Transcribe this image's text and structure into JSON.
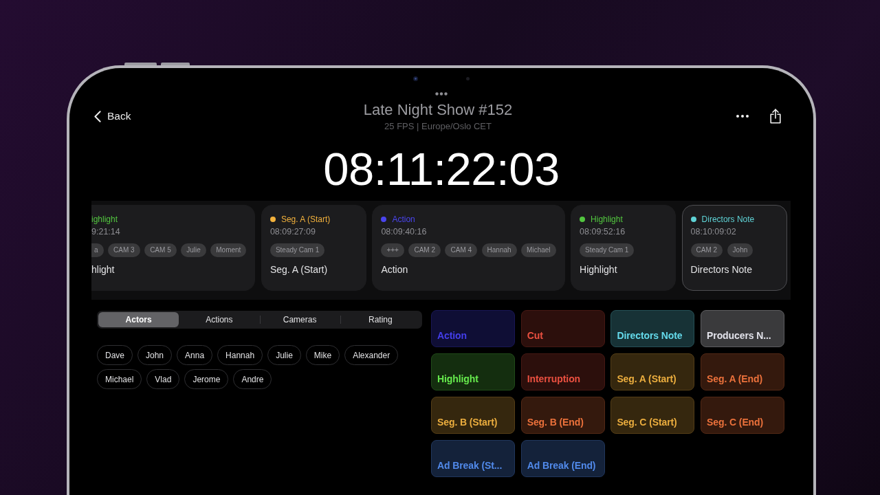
{
  "header": {
    "back": "Back",
    "title": "Late Night Show #152",
    "subtitle": "25 FPS | Europe/Oslo CET"
  },
  "timecode": "08:11:22:03",
  "markers": [
    {
      "clipped": true,
      "type": "ighlight",
      "color": "#52c63f",
      "time": "9:21:14",
      "tags": [
        "a",
        "CAM 3",
        "CAM 5",
        "Julie",
        "Moment"
      ],
      "title": "hlight",
      "selected": false
    },
    {
      "clipped": false,
      "type": "Seg. A (Start)",
      "color": "#f2b13c",
      "time": "08:09:27:09",
      "tags": [
        "Steady Cam 1"
      ],
      "title": "Seg. A (Start)",
      "selected": false
    },
    {
      "clipped": false,
      "type": "Action",
      "color": "#4a45ee",
      "time": "08:09:40:16",
      "tags": [
        "+++",
        "CAM 2",
        "CAM 4",
        "Hannah",
        "Michael"
      ],
      "title": "Action",
      "selected": false
    },
    {
      "clipped": false,
      "type": "Highlight",
      "color": "#52c63f",
      "time": "08:09:52:16",
      "tags": [
        "Steady Cam 1"
      ],
      "title": "Highlight",
      "selected": false
    },
    {
      "clipped": false,
      "type": "Directors Note",
      "color": "#5fd3d6",
      "time": "08:10:09:02",
      "tags": [
        "CAM 2",
        "John"
      ],
      "title": "Directors Note",
      "selected": true
    }
  ],
  "tabs": [
    {
      "label": "Actors",
      "selected": true
    },
    {
      "label": "Actions",
      "selected": false
    },
    {
      "label": "Cameras",
      "selected": false
    },
    {
      "label": "Rating",
      "selected": false
    }
  ],
  "actors": [
    {
      "name": "Dave",
      "selected": false
    },
    {
      "name": "John",
      "selected": false
    },
    {
      "name": "Anna",
      "selected": false
    },
    {
      "name": "Hannah",
      "selected": false
    },
    {
      "name": "Julie",
      "selected": false
    },
    {
      "name": "Mike",
      "selected": false
    },
    {
      "name": "Alexander",
      "selected": false
    },
    {
      "name": "Michael",
      "selected": false
    },
    {
      "name": "Vlad",
      "selected": false
    },
    {
      "name": "Jerome",
      "selected": false
    },
    {
      "name": "Andre",
      "selected": false
    }
  ],
  "buttons": [
    {
      "label": "Action",
      "color": "#0f0e35"
    },
    {
      "label": "Cut",
      "color": "#2c0f0c"
    },
    {
      "label": "Directors Note",
      "color": "#173236"
    },
    {
      "label": "Producers N...",
      "color": "#3a3a3c"
    },
    {
      "label": "Highlight",
      "color": "#142e0f"
    },
    {
      "label": "Interruption",
      "color": "#2c0f0c"
    },
    {
      "label": "Seg. A (Start)",
      "color": "#35270e"
    },
    {
      "label": "Seg. A (End)",
      "color": "#34190d"
    },
    {
      "label": "Seg. B (Start)",
      "color": "#35270e"
    },
    {
      "label": "Seg. B (End)",
      "color": "#34190d"
    },
    {
      "label": "Seg. C (Start)",
      "color": "#35270e"
    },
    {
      "label": "Seg. C (End)",
      "color": "#34190d"
    },
    {
      "label": "Ad Break (St...",
      "color": "#14223a"
    },
    {
      "label": "Ad Break (End)",
      "color": "#14223a"
    }
  ]
}
